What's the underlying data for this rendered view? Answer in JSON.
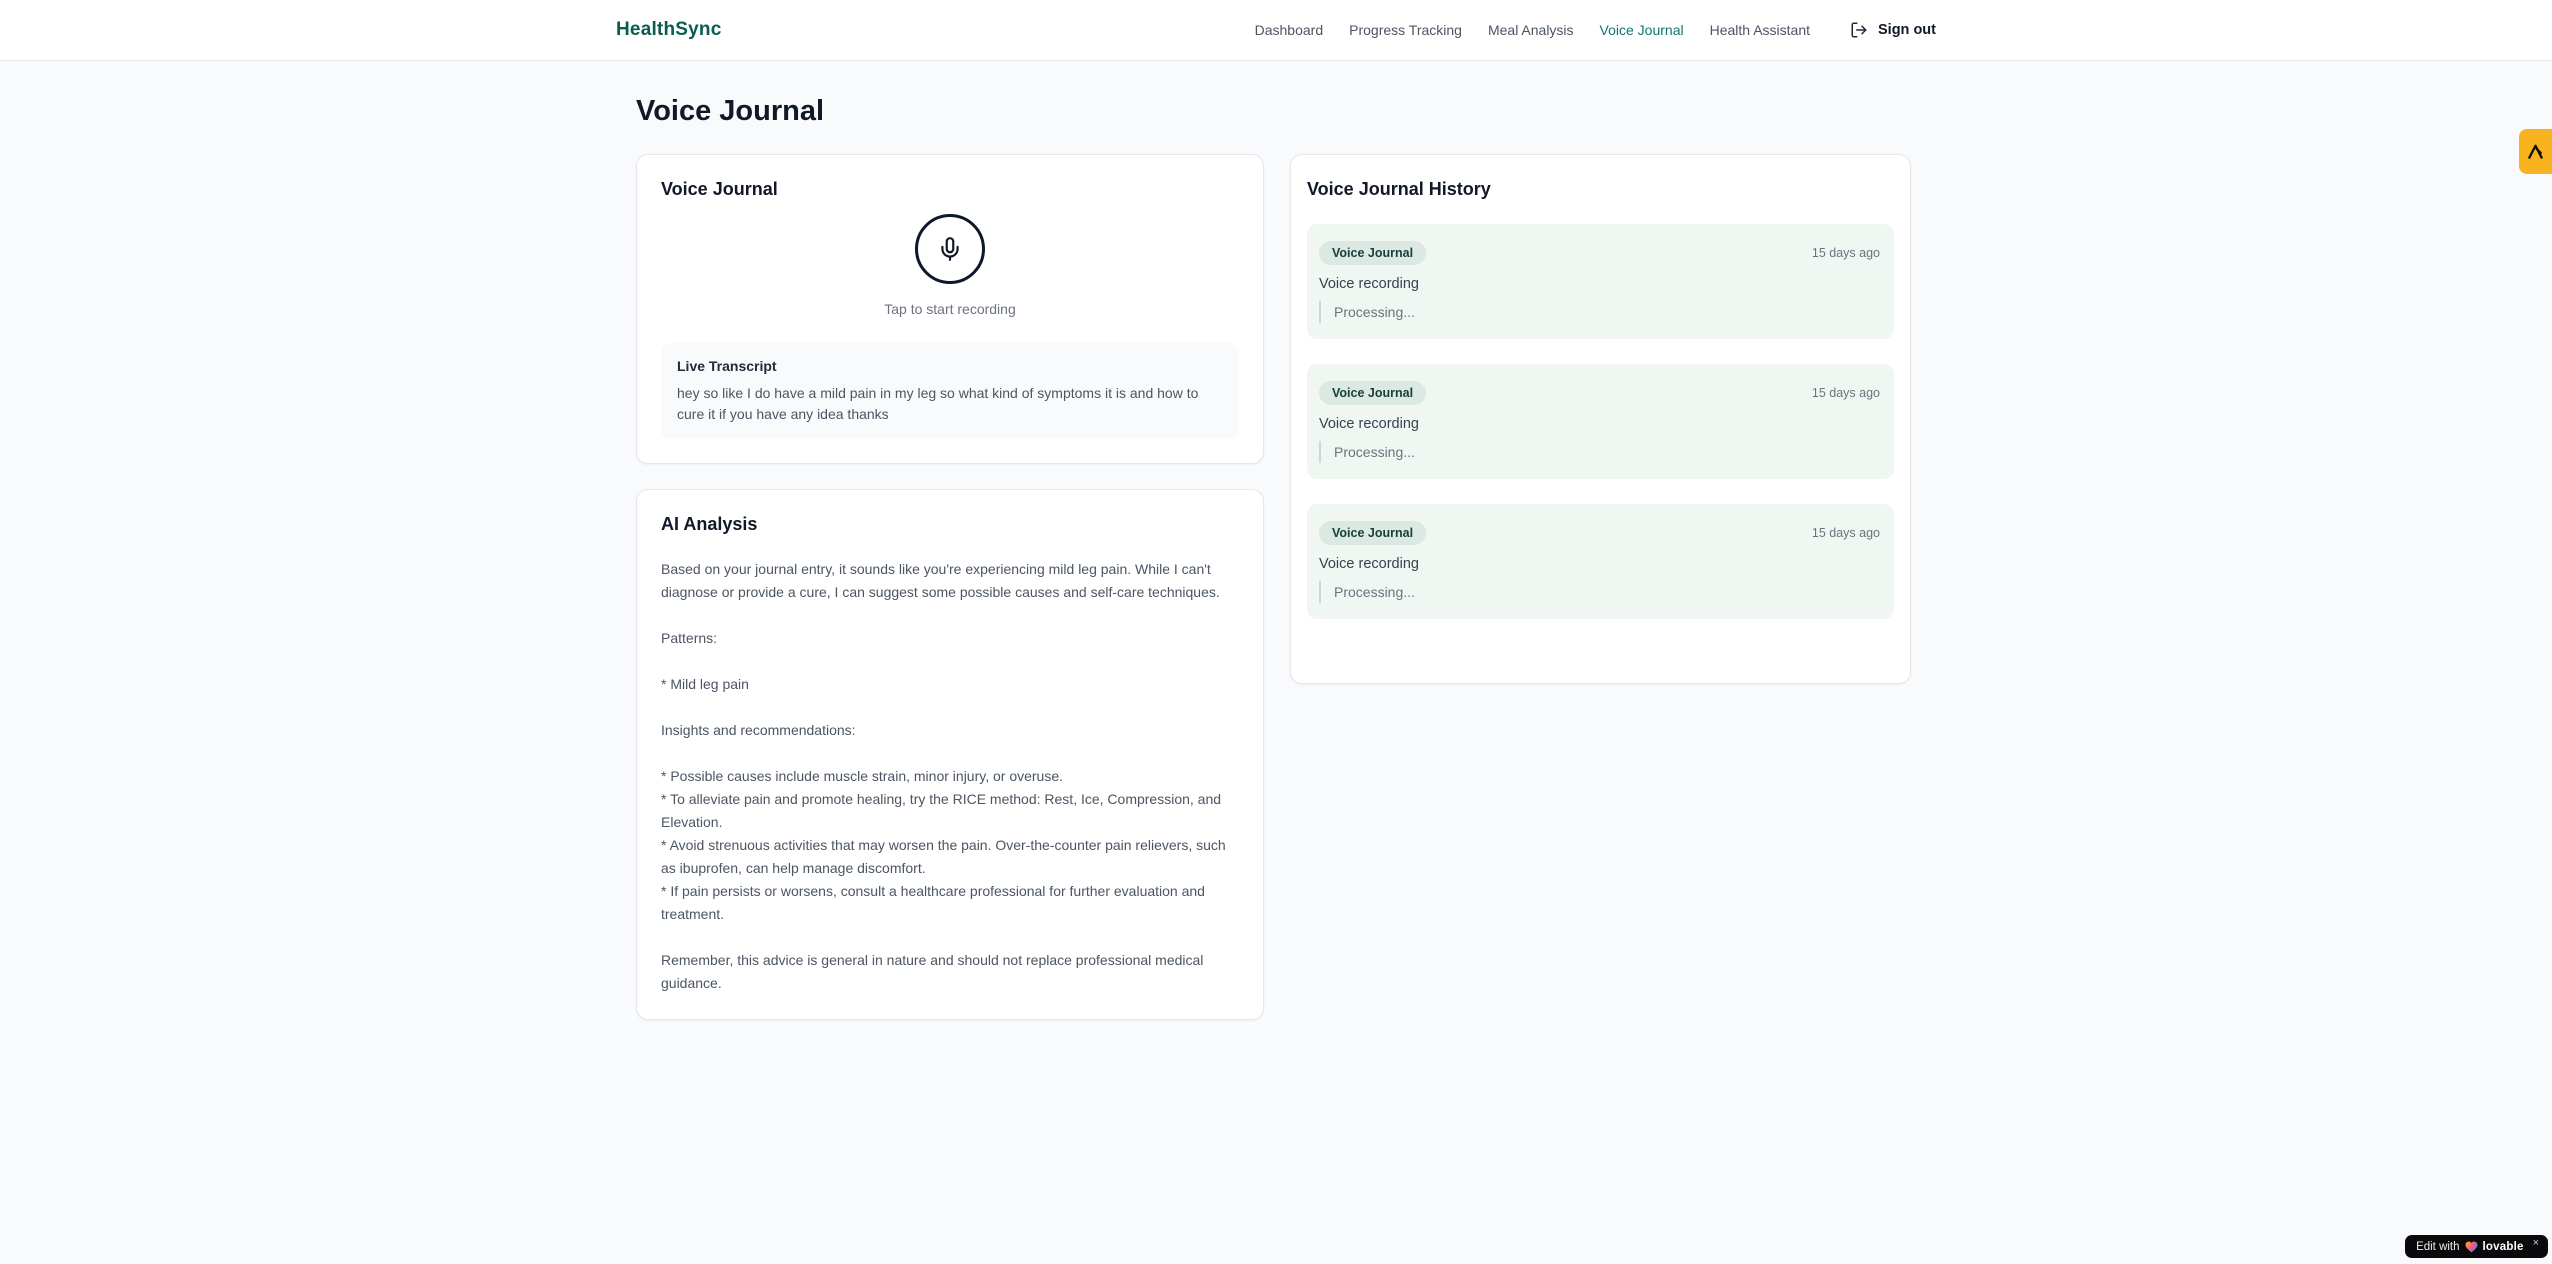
{
  "colors": {
    "brand-green": "#0a5d4e",
    "nav-active": "#0f766e",
    "amber": "#f8b31e",
    "entry-bg": "#f0f7f2",
    "badge-bg": "#dbe9e2"
  },
  "header": {
    "logo": "HealthSync",
    "nav": {
      "items": [
        {
          "label": "Dashboard"
        },
        {
          "label": "Progress Tracking"
        },
        {
          "label": "Meal Analysis"
        },
        {
          "label": "Voice Journal"
        },
        {
          "label": "Health Assistant"
        }
      ],
      "active": "Voice Journal"
    },
    "signout_label": "Sign out"
  },
  "page": {
    "title": "Voice Journal"
  },
  "recorder": {
    "card_title": "Voice Journal",
    "caption": "Tap to start recording",
    "transcript_title": "Live Transcript",
    "transcript_text": "hey so like I do have a mild pain in my leg so what kind of symptoms it is and how to cure it if you have any idea thanks"
  },
  "analysis": {
    "card_title": "AI Analysis",
    "body": "Based on your journal entry, it sounds like you're experiencing mild leg pain. While I can't diagnose or provide a cure, I can suggest some possible causes and self-care techniques.\n\nPatterns:\n\n* Mild leg pain\n\nInsights and recommendations:\n\n* Possible causes include muscle strain, minor injury, or overuse.\n* To alleviate pain and promote healing, try the RICE method: Rest, Ice, Compression, and Elevation.\n* Avoid strenuous activities that may worsen the pain. Over-the-counter pain relievers, such as ibuprofen, can help manage discomfort.\n* If pain persists or worsens, consult a healthcare professional for further evaluation and treatment.\n\nRemember, this advice is general in nature and should not replace professional medical guidance."
  },
  "history": {
    "card_title": "Voice Journal History",
    "entries": [
      {
        "type_label": "Voice Journal",
        "time": "15 days ago",
        "title": "Voice recording",
        "status": "Processing..."
      },
      {
        "type_label": "Voice Journal",
        "time": "15 days ago",
        "title": "Voice recording",
        "status": "Processing..."
      },
      {
        "type_label": "Voice Journal",
        "time": "15 days ago",
        "title": "Voice recording",
        "status": "Processing..."
      }
    ]
  },
  "widgets": {
    "edit_with": "Edit with",
    "lovable": "lovable",
    "close": "×"
  }
}
